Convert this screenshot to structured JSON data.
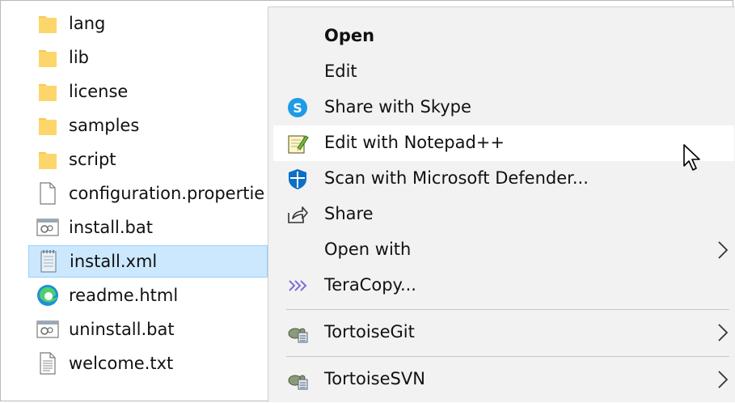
{
  "files": [
    {
      "label": "lang",
      "icon": "folder-icon"
    },
    {
      "label": "lib",
      "icon": "folder-icon"
    },
    {
      "label": "license",
      "icon": "folder-icon"
    },
    {
      "label": "samples",
      "icon": "folder-icon"
    },
    {
      "label": "script",
      "icon": "folder-icon"
    },
    {
      "label": "configuration.propertie",
      "icon": "blank-file-icon"
    },
    {
      "label": "install.bat",
      "icon": "batch-file-icon"
    },
    {
      "label": "install.xml",
      "icon": "xml-file-icon",
      "selected": true
    },
    {
      "label": "readme.html",
      "icon": "edge-icon"
    },
    {
      "label": "uninstall.bat",
      "icon": "batch-file-icon"
    },
    {
      "label": "welcome.txt",
      "icon": "text-file-icon"
    }
  ],
  "menu": {
    "items": [
      {
        "label": "Open",
        "bold": true
      },
      {
        "label": "Edit"
      },
      {
        "label": "Share with Skype",
        "icon": "skype-icon"
      },
      {
        "label": "Edit with Notepad++",
        "icon": "notepad-plus-plus-icon",
        "hovered": true
      },
      {
        "label": "Scan with Microsoft Defender...",
        "icon": "defender-shield-icon"
      },
      {
        "label": "Share",
        "icon": "share-icon"
      },
      {
        "label": "Open with",
        "submenu": true
      },
      {
        "label": "TeraCopy...",
        "icon": "teracopy-icon"
      },
      {
        "label": "TortoiseGit",
        "icon": "tortoisegit-icon",
        "submenu": true
      },
      {
        "label": "TortoiseSVN",
        "icon": "tortoisesvn-icon",
        "submenu": true
      }
    ]
  },
  "colors": {
    "selection_bg": "#cce8ff",
    "menu_bg": "#f2f2f2",
    "folder": "#f8c74c",
    "skype": "#1e9be6",
    "defender": "#0b6fc7"
  }
}
